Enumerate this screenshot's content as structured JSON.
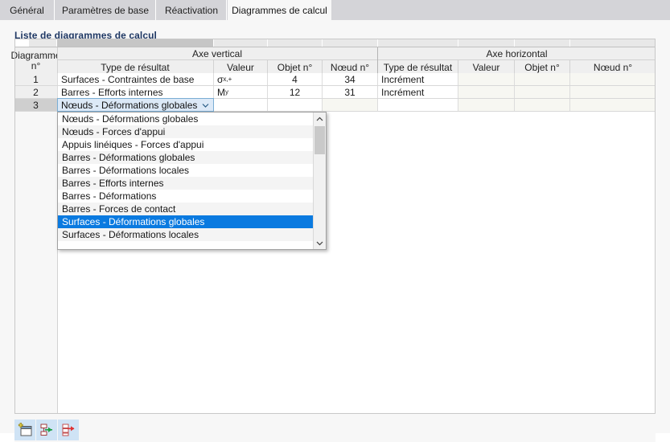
{
  "tabs": [
    {
      "label": "Général",
      "active": false
    },
    {
      "label": "Paramètres de base",
      "active": false
    },
    {
      "label": "Réactivation",
      "active": false
    },
    {
      "label": "Diagrammes de calcul",
      "active": true
    }
  ],
  "panel": {
    "title": "Liste de diagrammes de calcul"
  },
  "table": {
    "index_header_line1": "Diagramme",
    "index_header_line2": "n°",
    "groups": {
      "vertical": "Axe vertical",
      "horizontal": "Axe horizontal"
    },
    "columns": {
      "v_type": "Type de résultat",
      "v_valeur": "Valeur",
      "v_objet": "Objet n°",
      "v_noeud": "Nœud n°",
      "h_type": "Type de résultat",
      "h_valeur": "Valeur",
      "h_objet": "Objet n°",
      "h_noeud": "Nœud n°"
    },
    "rows": [
      {
        "index": "1",
        "v_type": "Surfaces - Contraintes de base",
        "v_valeur_base": "σ",
        "v_valeur_sub": "x,+",
        "v_objet": "4",
        "v_noeud": "34",
        "h_type": "Incrément",
        "h_valeur": "",
        "h_objet": "",
        "h_noeud": "",
        "selected": false,
        "editing": false
      },
      {
        "index": "2",
        "v_type": "Barres - Efforts internes",
        "v_valeur_base": "M",
        "v_valeur_sub": "y",
        "v_objet": "12",
        "v_noeud": "31",
        "h_type": "Incrément",
        "h_valeur": "",
        "h_objet": "",
        "h_noeud": "",
        "selected": false,
        "editing": false
      },
      {
        "index": "3",
        "v_type": "Nœuds - Déformations globales",
        "v_valeur_base": "",
        "v_valeur_sub": "",
        "v_objet": "",
        "v_noeud": "",
        "h_type": "",
        "h_valeur": "",
        "h_objet": "",
        "h_noeud": "",
        "selected": true,
        "editing": true
      }
    ]
  },
  "combo": {
    "value": "Nœuds - Déformations globales",
    "caret_icon": "chevron-down-icon"
  },
  "dropdown": {
    "selected_index": 8,
    "items": [
      "Nœuds - Déformations globales",
      "Nœuds - Forces d'appui",
      "Appuis linéiques - Forces d'appui",
      "Barres - Déformations globales",
      "Barres - Déformations locales",
      "Barres - Efforts internes",
      "Barres - Déformations",
      "Barres - Forces de contact",
      "Surfaces - Déformations globales",
      "Surfaces - Déformations locales"
    ],
    "scroll_up_icon": "chevron-up-icon",
    "scroll_down_icon": "chevron-down-icon"
  },
  "toolbar": {
    "buttons": [
      {
        "name": "new-diagram-button",
        "icon": "new-window-plus-icon"
      },
      {
        "name": "insert-row-button",
        "icon": "insert-row-green-arrow-icon"
      },
      {
        "name": "export-row-button",
        "icon": "export-row-red-arrow-icon"
      }
    ]
  },
  "colors": {
    "accent_selection": "#0a7ae0",
    "title_text": "#1f3864",
    "combo_fill": "#dce9f7",
    "toolbar_button_fill": "#cfe3f5",
    "header_fill": "#efefef"
  }
}
